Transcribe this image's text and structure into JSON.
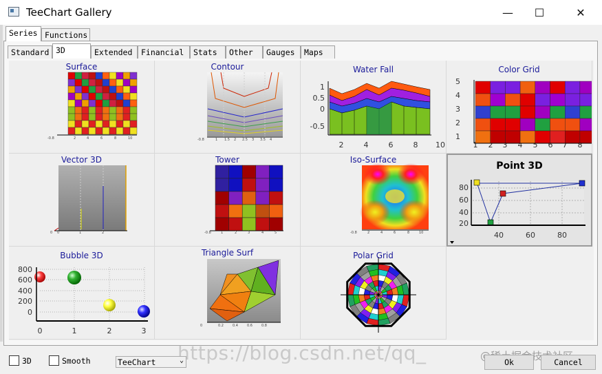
{
  "window": {
    "title": "TeeChart Gallery",
    "minimize": "—",
    "maximize": "☐",
    "close": "✕"
  },
  "top_tabs": [
    "Series",
    "Functions"
  ],
  "sub_tabs": [
    "Standard",
    "3D",
    "Extended",
    "Financial",
    "Stats",
    "Other",
    "Gauges",
    "Maps"
  ],
  "gallery": [
    {
      "title": "Surface"
    },
    {
      "title": "Contour"
    },
    {
      "title": "Water Fall"
    },
    {
      "title": "Color Grid"
    },
    {
      "title": "Vector 3D"
    },
    {
      "title": "Tower"
    },
    {
      "title": "Iso-Surface"
    },
    {
      "title": "Point 3D"
    },
    {
      "title": "Bubble 3D"
    },
    {
      "title": "Triangle Surf"
    },
    {
      "title": "Polar Grid"
    }
  ],
  "colors": {
    "title_blue": "#1a1a99",
    "selected_border": "#9a9a9a"
  },
  "chart_data": [
    {
      "type": "area",
      "title": "Water Fall",
      "yticks": [
        "1",
        "0.5",
        "0",
        "-0.5"
      ],
      "xticks": [
        "2",
        "4",
        "6",
        "8",
        "10"
      ]
    },
    {
      "type": "heatmap",
      "title": "Color Grid",
      "yticks": [
        "5",
        "4",
        "3",
        "2",
        "1"
      ],
      "xticks": [
        "1",
        "2",
        "3",
        "4",
        "5",
        "6",
        "7",
        "8",
        "9"
      ]
    },
    {
      "type": "line",
      "title": "Point 3D",
      "yticks": [
        "80",
        "60",
        "40",
        "20"
      ],
      "xticks": [
        "40",
        "60",
        "80"
      ]
    },
    {
      "type": "scatter",
      "title": "Bubble 3D",
      "yticks": [
        "800",
        "600",
        "400",
        "200",
        "0"
      ],
      "xticks": [
        "0",
        "1",
        "2",
        "3"
      ]
    }
  ],
  "bottom": {
    "check_3d": "3D",
    "check_smooth": "Smooth",
    "combo_value": "TeeChart",
    "combo_arrow": "⌄",
    "ok": "Ok",
    "cancel": "Cancel"
  },
  "watermark": {
    "url": "https://blog.csdn.net/qq_",
    "brand": "@稀土掘金技术社区"
  }
}
